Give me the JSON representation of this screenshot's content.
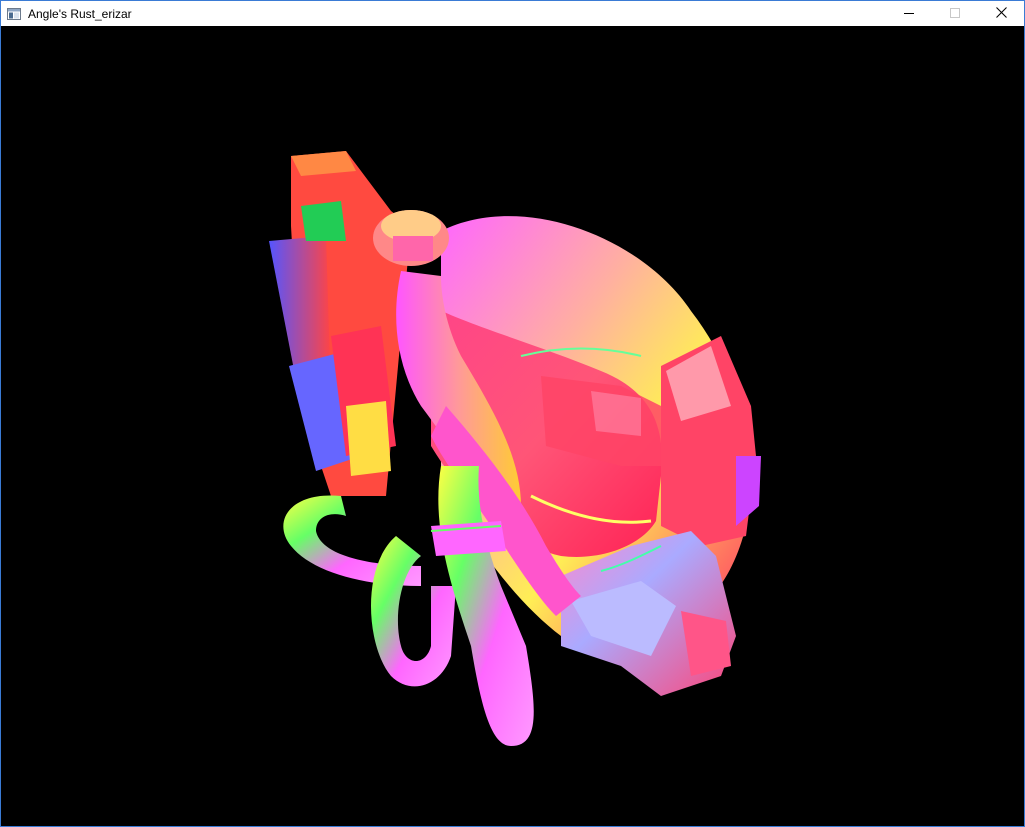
{
  "window": {
    "title": "Angle's Rust_erizar",
    "app_icon": "window-app-icon",
    "controls": {
      "minimize": "minimize-icon",
      "maximize": "maximize-icon",
      "close": "close-icon"
    }
  },
  "viewport": {
    "background": "#000000",
    "render_mode": "normal-map shading",
    "model_icon": "rendered-3d-model"
  }
}
